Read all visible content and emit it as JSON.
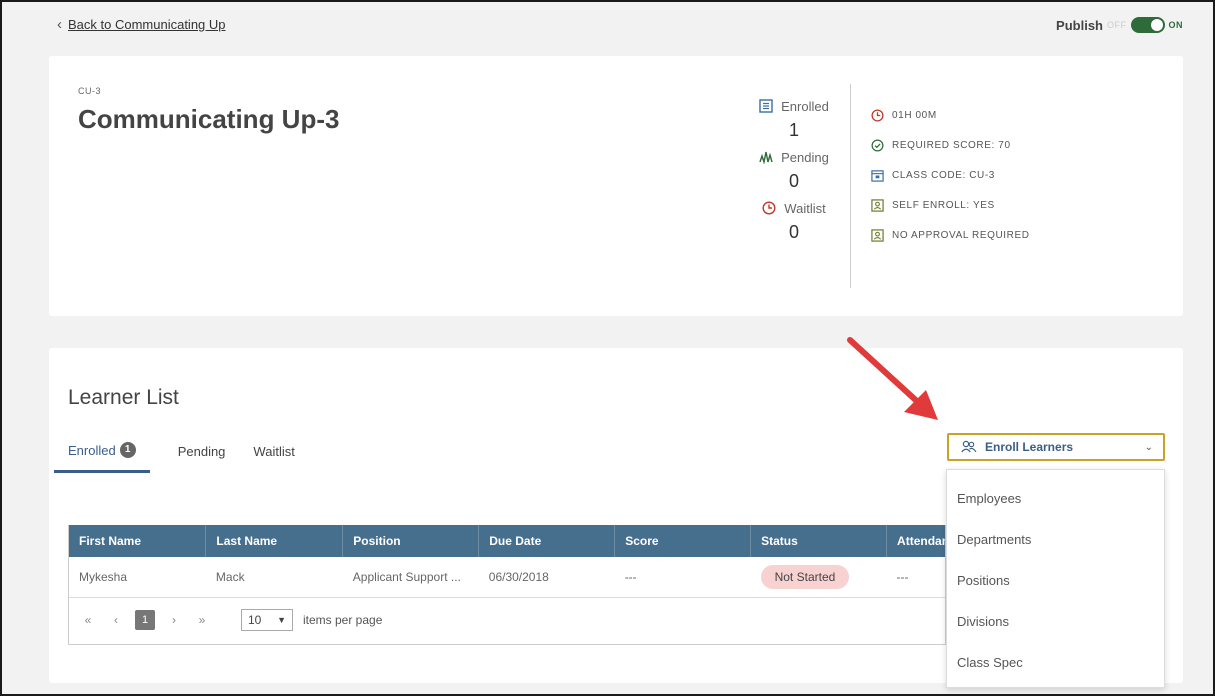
{
  "topbar": {
    "back_label": "Back to Communicating Up",
    "publish_label": "Publish",
    "off_label": "OFF",
    "on_label": "ON"
  },
  "course": {
    "code_small": "CU-3",
    "title": "Communicating Up-3"
  },
  "stats": [
    {
      "label": "Enrolled",
      "value": "1",
      "icon": "book-icon"
    },
    {
      "label": "Pending",
      "value": "0",
      "icon": "activity-icon"
    },
    {
      "label": "Waitlist",
      "value": "0",
      "icon": "clock-icon"
    }
  ],
  "meta": [
    {
      "text": "01H 00M",
      "icon": "clock-icon"
    },
    {
      "text": "REQUIRED SCORE: 70",
      "icon": "check-circle-icon"
    },
    {
      "text": "CLASS CODE: CU-3",
      "icon": "calendar-icon"
    },
    {
      "text": "SELF ENROLL: YES",
      "icon": "badge-icon"
    },
    {
      "text": "NO APPROVAL REQUIRED",
      "icon": "badge-icon"
    }
  ],
  "learner_list": {
    "title": "Learner List",
    "tabs": [
      {
        "label": "Enrolled",
        "badge": "1"
      },
      {
        "label": "Pending"
      },
      {
        "label": "Waitlist"
      }
    ],
    "enroll_button": "Enroll Learners",
    "columns": [
      "First Name",
      "Last Name",
      "Position",
      "Due Date",
      "Score",
      "Status",
      "Attendance"
    ],
    "rows": [
      {
        "first": "Mykesha",
        "last": "Mack",
        "position": "Applicant Support ...",
        "due": "06/30/2018",
        "score": "---",
        "status": "Not Started",
        "attendance": "---"
      }
    ],
    "pager": {
      "current": "1",
      "page_size": "10",
      "items_label": "items per page"
    }
  },
  "dropdown": {
    "options": [
      "Employees",
      "Departments",
      "Positions",
      "Divisions",
      "Class Spec"
    ]
  },
  "colors": {
    "accent": "#3a5e8a",
    "table_header": "#466e8d",
    "toggle_on": "#2e6b3a",
    "status_pill": "#f8d1d1",
    "highlight_border": "#c9a227",
    "arrow": "#e03a3a"
  }
}
